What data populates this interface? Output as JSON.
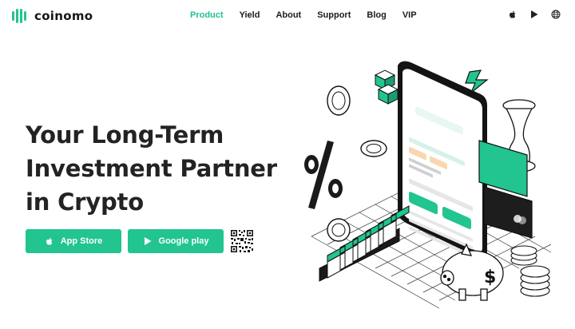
{
  "header": {
    "brand": "coinomo",
    "nav": [
      "Product",
      "Yield",
      "About",
      "Support",
      "Blog",
      "VIP"
    ],
    "active_nav": "Product",
    "icons": [
      "apple-icon",
      "play-store-icon",
      "globe-icon"
    ]
  },
  "hero": {
    "title_lines": [
      "Your Long-Term",
      "Investment Partner",
      "in Crypto"
    ],
    "buttons": {
      "app_store": "App Store",
      "google_play": "Google play"
    }
  },
  "colors": {
    "accent": "#22c490",
    "nav_active": "#1fc094",
    "text_dark": "#232323"
  }
}
